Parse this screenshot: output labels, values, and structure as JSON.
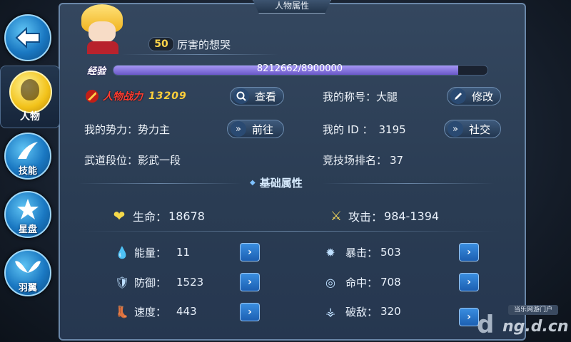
{
  "window": {
    "title": "人物属性"
  },
  "nav": {
    "back": {
      "icon": "back-arrow-icon"
    },
    "items": [
      {
        "label": "人物",
        "icon": "character-icon",
        "active": true
      },
      {
        "label": "技能",
        "icon": "skill-icon",
        "active": false
      },
      {
        "label": "星盘",
        "icon": "star-disc-icon",
        "active": false
      },
      {
        "label": "羽翼",
        "icon": "wings-icon",
        "active": false
      }
    ]
  },
  "profile": {
    "level": "50",
    "name": "厉害的想哭",
    "exp_label": "经验",
    "exp_text": "8212662/8900000",
    "exp_progress": 0.9227
  },
  "info": {
    "power_label": "人物战力",
    "power_value": "13209",
    "view_button": "查看",
    "title_label": "我的称号：大腿",
    "modify_button": "修改",
    "faction_label": "我的势力：",
    "faction_value": "势力主",
    "goto_button": "前往",
    "id_label": "我的 ID ：",
    "id_value": "3195",
    "social_button": "社交",
    "rank_label": "武道段位：",
    "rank_value": "影武一段",
    "arena_label": "竞技场排名：",
    "arena_value": "37"
  },
  "base_attr": {
    "section_title": "基础属性",
    "hp_label": "生命：",
    "hp_value": "18678",
    "atk_label": "攻击：",
    "atk_value": "984-1394",
    "left": [
      {
        "label": "能量：",
        "value": "11",
        "icon": "energy-drop-icon"
      },
      {
        "label": "防御：",
        "value": "1523",
        "icon": "shield-icon"
      },
      {
        "label": "速度：",
        "value": "443",
        "icon": "boot-icon"
      }
    ],
    "right": [
      {
        "label": "暴击：",
        "value": "503",
        "icon": "crit-burst-icon"
      },
      {
        "label": "命中：",
        "value": "708",
        "icon": "target-icon"
      },
      {
        "label": "破敌：",
        "value": "320",
        "icon": "break-icon"
      }
    ]
  },
  "watermark": {
    "site": "ng.d.cn",
    "badge": "当乐网游门户"
  },
  "colors": {
    "accent": "#1c6fd0",
    "exp_bar": "#7b6bd6",
    "power": "#ff3c30",
    "heart": "#f5d94a"
  }
}
